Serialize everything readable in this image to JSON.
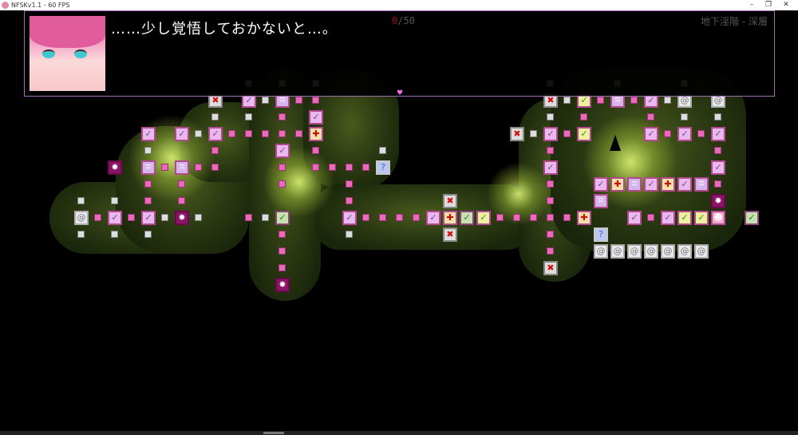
{
  "window": {
    "title": "NFSKv1.1 - 60 FPS",
    "minimize": "–",
    "restore": "❐",
    "close": "✕"
  },
  "dialog": {
    "text": "……少し覚悟しておかないと…。",
    "speaker_portrait": "pink-haired-girl-portrait"
  },
  "hud": {
    "counter_current": "0",
    "counter_total": "/50",
    "location": "地下淫階 - 深層",
    "continue_icon": "♥"
  },
  "tile_glyphs": {
    "check": "✓",
    "bunny": "ʭ",
    "burst": "✸",
    "cross_x": "✖",
    "plus": "✚",
    "question": "?",
    "spiral": "@",
    "player": "☻"
  },
  "colors": {
    "accent_pink": "#e86bb8",
    "dialog_border": "#a070b0",
    "counter_current": "#a01010"
  }
}
